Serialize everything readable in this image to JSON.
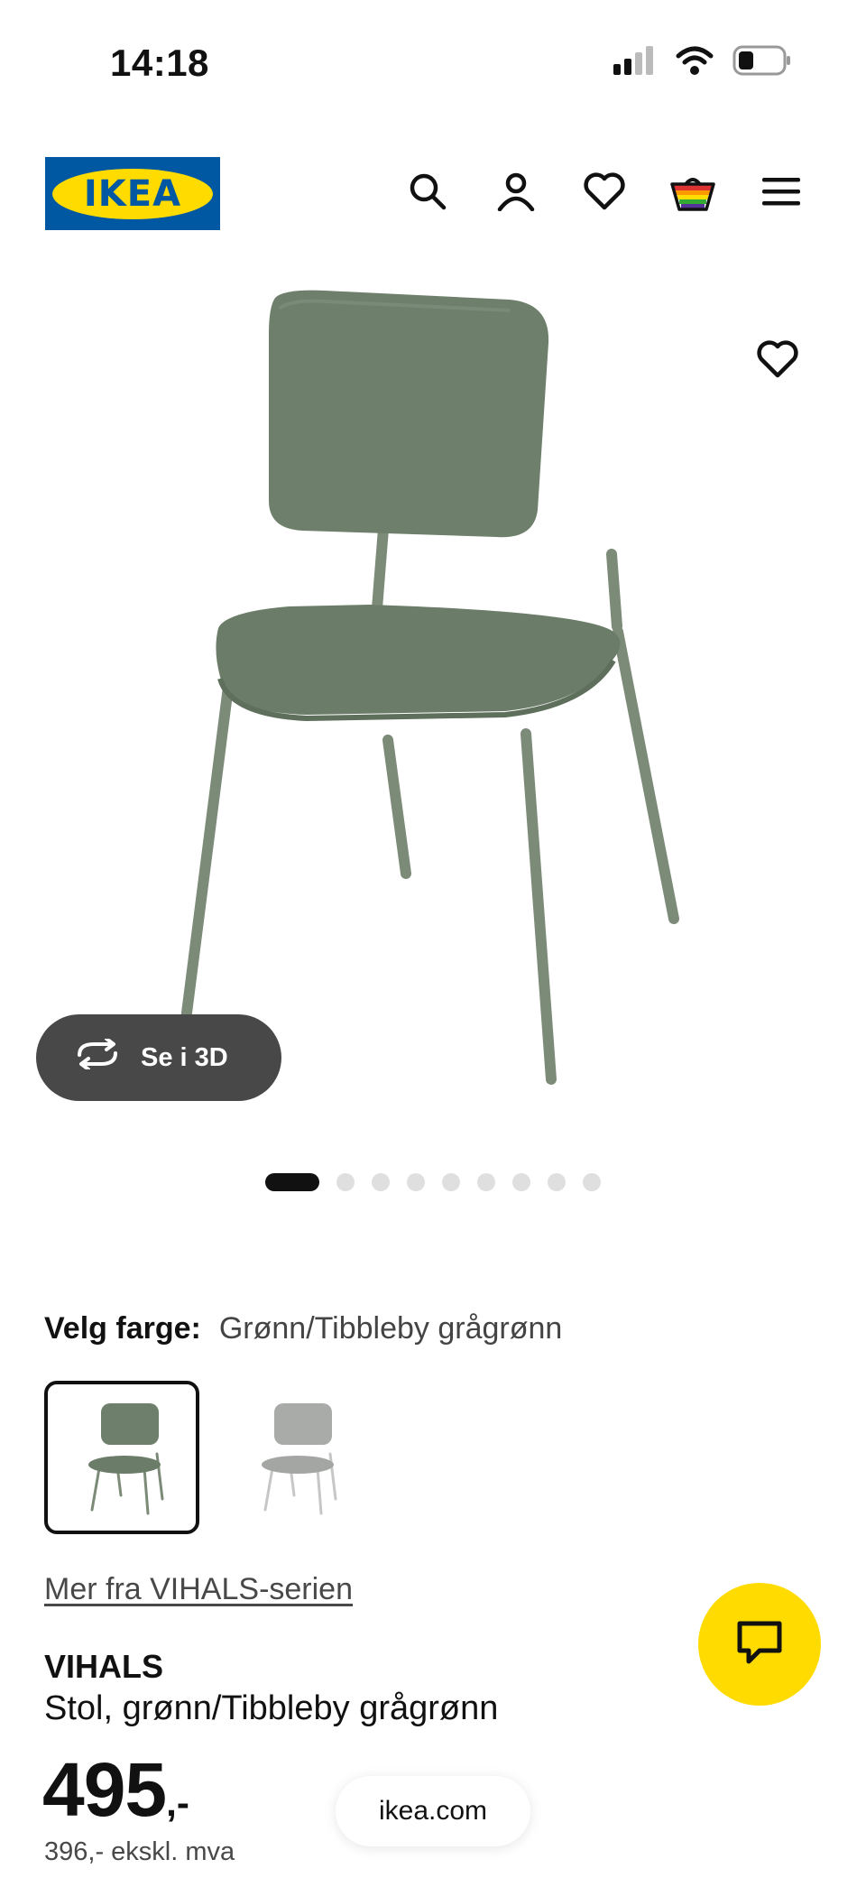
{
  "status_bar": {
    "time": "14:18",
    "icons": [
      "cellular-signal-icon",
      "wifi-icon",
      "battery-icon"
    ]
  },
  "header": {
    "logo_text": "IKEA",
    "icons": [
      "search-icon",
      "profile-icon",
      "heart-icon",
      "shopping-bag-icon",
      "menu-icon"
    ]
  },
  "gallery": {
    "view_3d_label": "Se i 3D",
    "image_count": 9,
    "current_index": 0
  },
  "color_selector": {
    "label": "Velg farge:",
    "selected_value": "Grønn/Tibbleby grågrønn",
    "options": [
      "green",
      "grey"
    ]
  },
  "series_link": "Mer fra VIHALS-serien",
  "product": {
    "name": "VIHALS",
    "description": "Stol, grønn/Tibbleby grågrønn",
    "price": "495",
    "price_suffix": ",-",
    "price_excl_vat": "396,- ekskl. mva"
  },
  "browser": {
    "domain": "ikea.com"
  },
  "colors": {
    "brand_blue": "#0058A3",
    "brand_yellow": "#FFDB00",
    "chair_green": "#6E806B"
  }
}
